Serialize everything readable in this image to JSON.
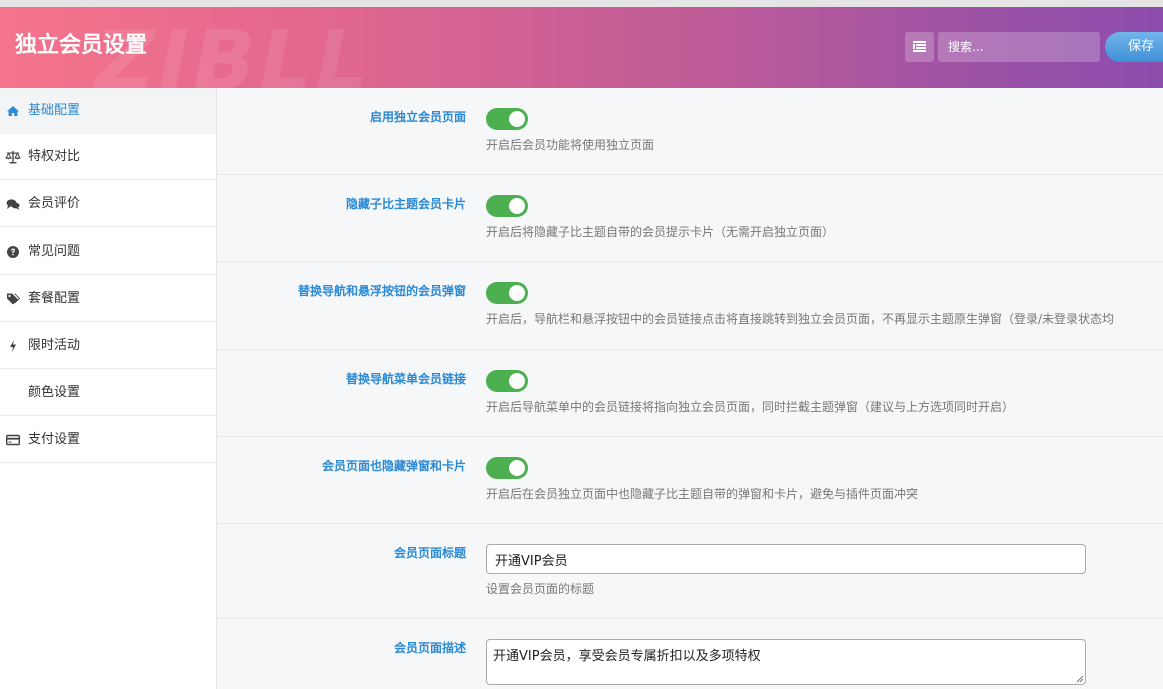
{
  "header": {
    "title": "独立会员设置",
    "watermark": "ZIBLL",
    "search_placeholder": "搜索...",
    "save_label": "保存",
    "expand_icon": "expand-all-icon"
  },
  "sidebar": {
    "items": [
      {
        "label": "基础配置",
        "icon": "home-icon",
        "active": true
      },
      {
        "label": "特权对比",
        "icon": "balance-scale-icon",
        "active": false
      },
      {
        "label": "会员评价",
        "icon": "comments-icon",
        "active": false
      },
      {
        "label": "常见问题",
        "icon": "question-circle-icon",
        "active": false
      },
      {
        "label": "套餐配置",
        "icon": "tags-icon",
        "active": false
      },
      {
        "label": "限时活动",
        "icon": "bolt-icon",
        "active": false
      },
      {
        "label": "颜色设置",
        "icon": "",
        "active": false
      },
      {
        "label": "支付设置",
        "icon": "credit-card-icon",
        "active": false
      }
    ]
  },
  "settings": [
    {
      "label": "启用独立会员页面",
      "type": "toggle",
      "value": true,
      "desc": "开启后会员功能将使用独立页面"
    },
    {
      "label": "隐藏子比主题会员卡片",
      "type": "toggle",
      "value": true,
      "desc": "开启后将隐藏子比主题自带的会员提示卡片（无需开启独立页面）"
    },
    {
      "label": "替换导航和悬浮按钮的会员弹窗",
      "type": "toggle",
      "value": true,
      "desc": "开启后，导航栏和悬浮按钮中的会员链接点击将直接跳转到独立会员页面，不再显示主题原生弹窗（登录/未登录状态均"
    },
    {
      "label": "替换导航菜单会员链接",
      "type": "toggle",
      "value": true,
      "desc": "开启后导航菜单中的会员链接将指向独立会员页面，同时拦截主题弹窗（建议与上方选项同时开启）"
    },
    {
      "label": "会员页面也隐藏弹窗和卡片",
      "type": "toggle",
      "value": true,
      "desc": "开启后在会员独立页面中也隐藏子比主题自带的弹窗和卡片，避免与插件页面冲突"
    },
    {
      "label": "会员页面标题",
      "type": "text",
      "value": "开通VIP会员",
      "desc": "设置会员页面的标题"
    },
    {
      "label": "会员页面描述",
      "type": "textarea",
      "value": "开通VIP会员，享受会员专属折扣以及多项特权",
      "desc": ""
    }
  ],
  "colors": {
    "accent": "#2c8ad4",
    "toggle_on": "#4caf50",
    "header_gradient_start": "#f5748c",
    "header_gradient_end": "#8c4cac"
  }
}
